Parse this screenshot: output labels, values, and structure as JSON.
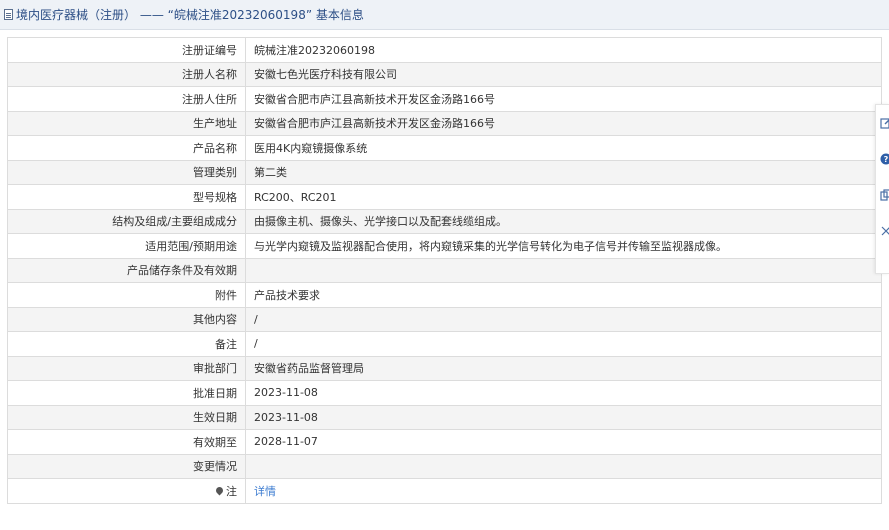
{
  "header": {
    "title": "境内医疗器械（注册） —— “皖械注准20232060198” 基本信息"
  },
  "rows": [
    {
      "label": "注册证编号",
      "value": "皖械注准20232060198"
    },
    {
      "label": "注册人名称",
      "value": "安徽七色光医疗科技有限公司"
    },
    {
      "label": "注册人住所",
      "value": "安徽省合肥市庐江县高新技术开发区金汤路166号"
    },
    {
      "label": "生产地址",
      "value": "安徽省合肥市庐江县高新技术开发区金汤路166号"
    },
    {
      "label": "产品名称",
      "value": "医用4K内窥镜摄像系统"
    },
    {
      "label": "管理类别",
      "value": "第二类"
    },
    {
      "label": "型号规格",
      "value": "RC200、RC201"
    },
    {
      "label": "结构及组成/主要组成成分",
      "value": "由摄像主机、摄像头、光学接口以及配套线缆组成。"
    },
    {
      "label": "适用范围/预期用途",
      "value": "与光学内窥镜及监视器配合使用，将内窥镜采集的光学信号转化为电子信号并传输至监视器成像。"
    },
    {
      "label": "产品储存条件及有效期",
      "value": ""
    },
    {
      "label": "附件",
      "value": "产品技术要求"
    },
    {
      "label": "其他内容",
      "value": "/"
    },
    {
      "label": "备注",
      "value": "/"
    },
    {
      "label": "审批部门",
      "value": "安徽省药品监督管理局"
    },
    {
      "label": "批准日期",
      "value": "2023-11-08"
    },
    {
      "label": "生效日期",
      "value": "2023-11-08"
    },
    {
      "label": "有效期至",
      "value": "2028-11-07"
    },
    {
      "label": "变更情况",
      "value": ""
    }
  ],
  "note_row": {
    "label": "注",
    "link": "详情"
  }
}
